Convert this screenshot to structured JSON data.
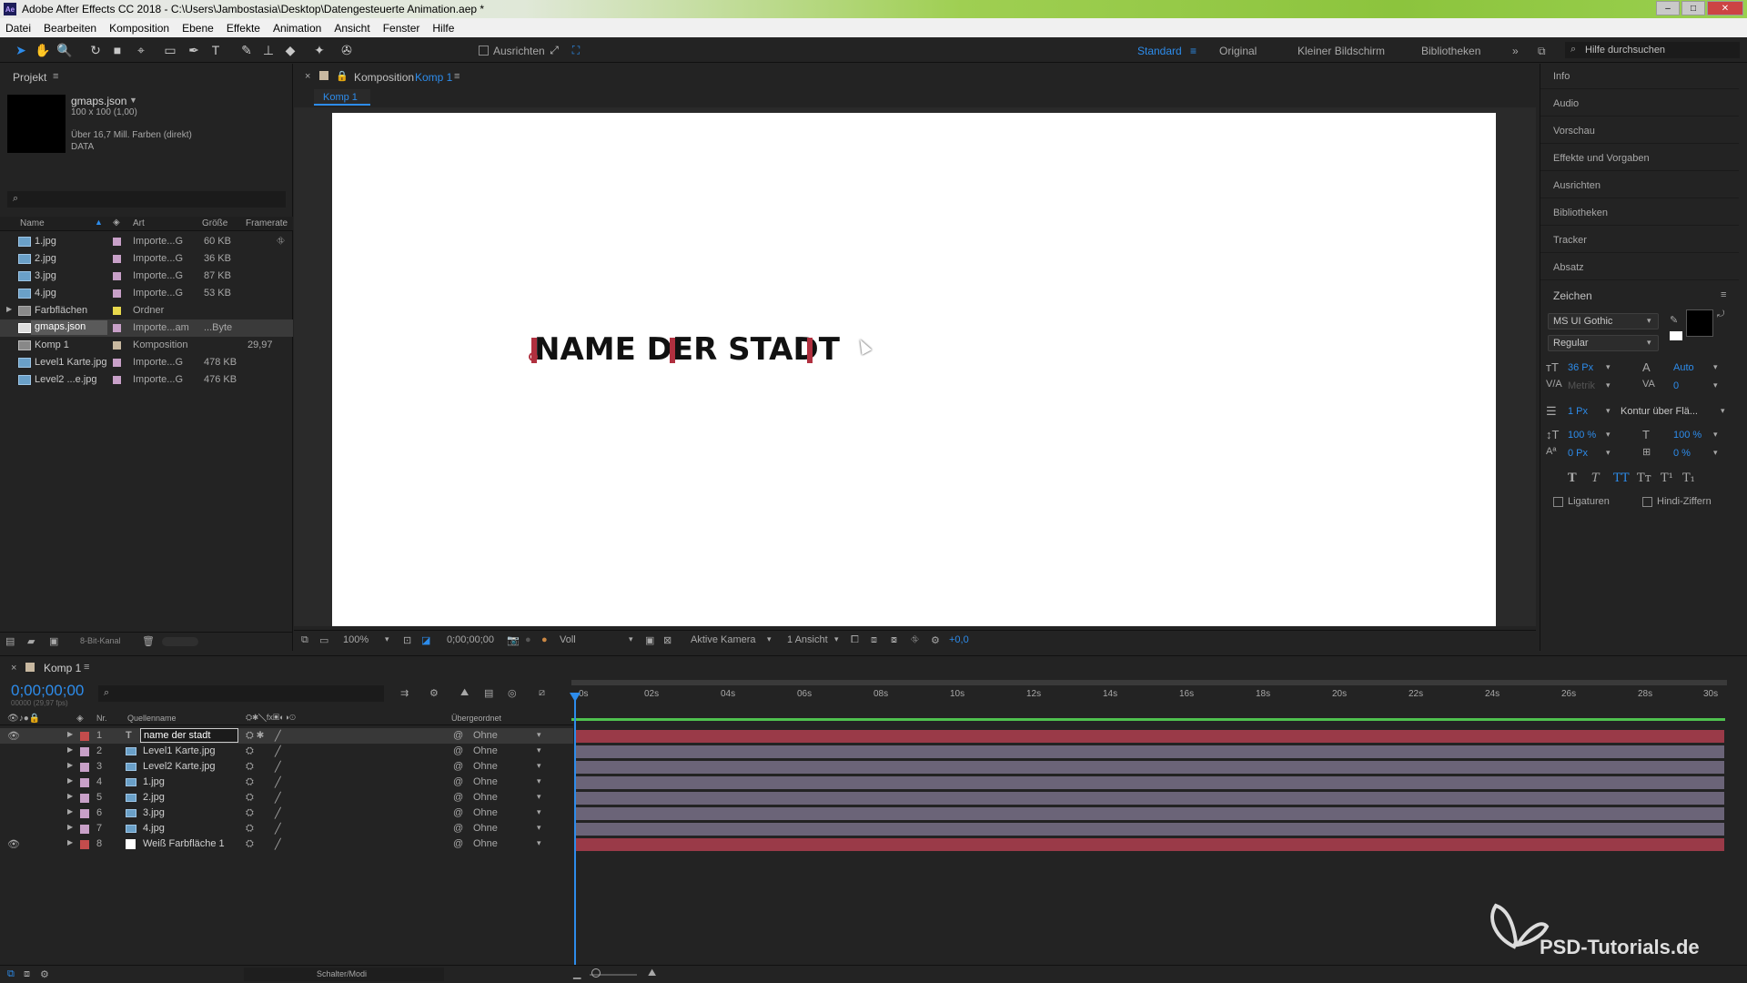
{
  "window": {
    "app_icon": "Ae",
    "title": "Adobe After Effects CC 2018 - C:\\Users\\Jambostasia\\Desktop\\Datengesteuerte Animation.aep *"
  },
  "menu": [
    "Datei",
    "Bearbeiten",
    "Komposition",
    "Ebene",
    "Effekte",
    "Animation",
    "Ansicht",
    "Fenster",
    "Hilfe"
  ],
  "toolbar": {
    "align_label": "Ausrichten",
    "workspaces": [
      "Standard",
      "Original",
      "Kleiner Bildschirm",
      "Bibliotheken"
    ],
    "active_workspace": "Standard",
    "search_placeholder": "Hilfe durchsuchen"
  },
  "project": {
    "title": "Projekt",
    "selected_name": "gmaps.json",
    "selected_info1": "100 x 100 (1,00)",
    "selected_info2": "Über 16,7 Mill. Farben (direkt)",
    "selected_info3": "DATA",
    "columns": [
      "Name",
      "Art",
      "Größe",
      "Framerate"
    ],
    "items": [
      {
        "name": "1.jpg",
        "type": "Importe...G",
        "size": "60 KB",
        "fps": "",
        "color": "#c8a0c8"
      },
      {
        "name": "2.jpg",
        "type": "Importe...G",
        "size": "36 KB",
        "fps": "",
        "color": "#c8a0c8"
      },
      {
        "name": "3.jpg",
        "type": "Importe...G",
        "size": "87 KB",
        "fps": "",
        "color": "#c8a0c8"
      },
      {
        "name": "4.jpg",
        "type": "Importe...G",
        "size": "53 KB",
        "fps": "",
        "color": "#c8a0c8"
      },
      {
        "name": "Farbflächen",
        "type": "Ordner",
        "size": "",
        "fps": "",
        "color": "#e8d84c"
      },
      {
        "name": "gmaps.json",
        "type": "Importe...am",
        "size": "...Byte",
        "fps": "",
        "color": "#c8a0c8"
      },
      {
        "name": "Komp 1",
        "type": "Komposition",
        "size": "",
        "fps": "29,97",
        "color": "#c8b8a0"
      },
      {
        "name": "Level1 Karte.jpg",
        "type": "Importe...G",
        "size": "478 KB",
        "fps": "",
        "color": "#c8a0c8"
      },
      {
        "name": "Level2 ...e.jpg",
        "type": "Importe...G",
        "size": "476 KB",
        "fps": "",
        "color": "#c8a0c8"
      }
    ],
    "bit_depth": "8-Bit-Kanal"
  },
  "composition": {
    "header": "Komposition",
    "comp_name": "Komp 1",
    "tab": "Komp 1",
    "canvas_text": "NAME DER STADT",
    "zoom": "100%",
    "timecode": "0;00;00;00",
    "resolution": "Voll",
    "camera": "Aktive Kamera",
    "views": "1 Ansicht",
    "exposure": "+0,0"
  },
  "right_panels": [
    "Info",
    "Audio",
    "Vorschau",
    "Effekte und Vorgaben",
    "Ausrichten",
    "Bibliotheken",
    "Tracker",
    "Absatz"
  ],
  "character": {
    "title": "Zeichen",
    "font": "MS UI Gothic",
    "style": "Regular",
    "size": "36 Px",
    "leading": "Auto",
    "kerning": "Metrik",
    "tracking": "0",
    "stroke": "1 Px",
    "stroke_mode": "Kontur über Flä...",
    "vscale": "100 %",
    "hscale": "100 %",
    "baseline": "0 Px",
    "tsume": "0 %",
    "ligatures": "Ligaturen",
    "hindi": "Hindi-Ziffern",
    "style_buttons": [
      "T",
      "T",
      "TT",
      "Tт",
      "T¹",
      "T₁"
    ]
  },
  "timeline": {
    "tab": "Komp 1",
    "timecode": "0;00;00;00",
    "timecode_sub": "00000 (29,97 fps)",
    "col_nr": "Nr.",
    "col_source": "Quellenname",
    "col_parent": "Übergeordnet",
    "ruler": [
      "0s",
      "02s",
      "04s",
      "06s",
      "08s",
      "10s",
      "12s",
      "14s",
      "16s",
      "18s",
      "20s",
      "22s",
      "24s",
      "26s",
      "28s",
      "30s"
    ],
    "layers": [
      {
        "nr": "1",
        "name": "name der stadt",
        "kind": "T",
        "color": "#c44c4c",
        "parent": "Ohne",
        "visible": true,
        "bar": "#9a3a48"
      },
      {
        "nr": "2",
        "name": "Level1 Karte.jpg",
        "kind": "img",
        "color": "#c8a0c8",
        "parent": "Ohne",
        "visible": false,
        "bar": "#6b6478"
      },
      {
        "nr": "3",
        "name": "Level2 Karte.jpg",
        "kind": "img",
        "color": "#c8a0c8",
        "parent": "Ohne",
        "visible": false,
        "bar": "#6b6478"
      },
      {
        "nr": "4",
        "name": "1.jpg",
        "kind": "img",
        "color": "#c8a0c8",
        "parent": "Ohne",
        "visible": false,
        "bar": "#6b6478"
      },
      {
        "nr": "5",
        "name": "2.jpg",
        "kind": "img",
        "color": "#c8a0c8",
        "parent": "Ohne",
        "visible": false,
        "bar": "#6b6478"
      },
      {
        "nr": "6",
        "name": "3.jpg",
        "kind": "img",
        "color": "#c8a0c8",
        "parent": "Ohne",
        "visible": false,
        "bar": "#6b6478"
      },
      {
        "nr": "7",
        "name": "4.jpg",
        "kind": "img",
        "color": "#c8a0c8",
        "parent": "Ohne",
        "visible": false,
        "bar": "#6b6478"
      },
      {
        "nr": "8",
        "name": "Weiß Farbfläche 1",
        "kind": "solid",
        "color": "#c44c4c",
        "parent": "Ohne",
        "visible": true,
        "bar": "#9a3a48"
      }
    ],
    "footer_label": "Schalter/Modi"
  },
  "watermark": "PSD-Tutorials.de",
  "colors": {
    "accent": "#2d8ceb",
    "bg": "#232323",
    "panel_dark": "#1b1b1b"
  }
}
